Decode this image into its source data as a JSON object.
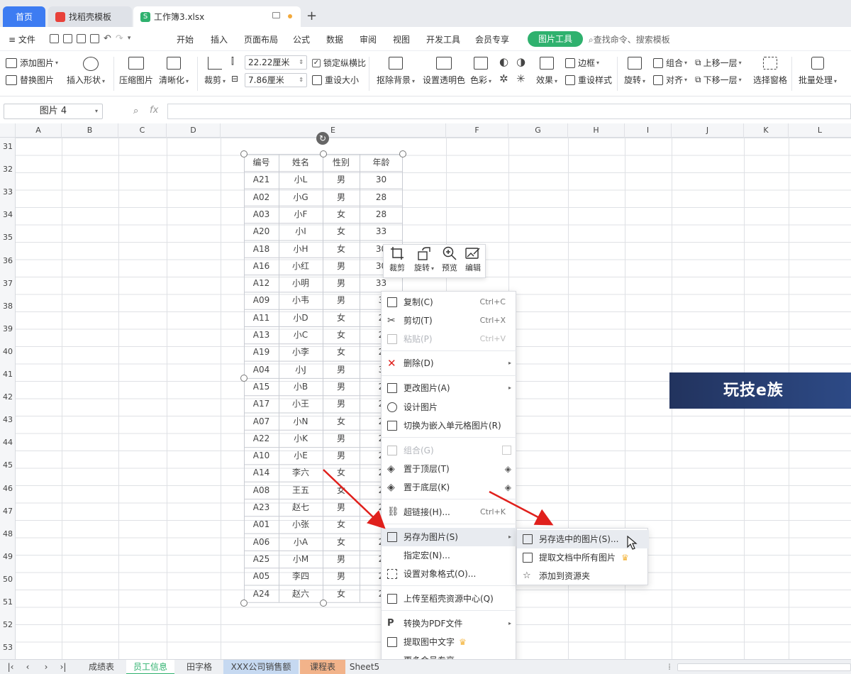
{
  "tabs": {
    "home": "首页",
    "template": "找稻壳模板",
    "workbook": "工作簿3.xlsx"
  },
  "menu": {
    "file": "文件",
    "items": [
      "开始",
      "插入",
      "页面布局",
      "公式",
      "数据",
      "审阅",
      "视图",
      "开发工具",
      "会员专享"
    ],
    "picture_tools": "图片工具",
    "search": "查找命令、搜索模板"
  },
  "ribbon": {
    "add_picture": "添加图片",
    "replace_picture": "替换图片",
    "insert_shape": "插入形状",
    "compress": "压缩图片",
    "clarify": "清晰化",
    "crop": "裁剪",
    "width": "22.22厘米",
    "height": "7.86厘米",
    "lock_ratio": "锁定纵横比",
    "reset_size": "重设大小",
    "remove_bg": "抠除背景",
    "set_transparent": "设置透明色",
    "color": "色彩",
    "effects": "效果",
    "border": "边框",
    "reset_style": "重设样式",
    "rotate": "旋转",
    "group": "组合",
    "align": "对齐",
    "bring_forward": "上移一层",
    "send_backward": "下移一层",
    "selection_pane": "选择窗格",
    "batch": "批量处理"
  },
  "formula_bar": {
    "name": "图片 4",
    "fx": "fx"
  },
  "columns": [
    "A",
    "B",
    "C",
    "D",
    "E",
    "F",
    "G",
    "H",
    "I",
    "J",
    "K",
    "L"
  ],
  "rows": [
    "31",
    "32",
    "33",
    "34",
    "35",
    "36",
    "37",
    "38",
    "39",
    "40",
    "41",
    "42",
    "43",
    "44",
    "45",
    "46",
    "47",
    "48",
    "49",
    "50",
    "51",
    "52",
    "53"
  ],
  "table": {
    "headers": [
      "编号",
      "姓名",
      "性别",
      "年龄"
    ],
    "rows": [
      [
        "A21",
        "小L",
        "男",
        "30"
      ],
      [
        "A02",
        "小G",
        "男",
        "28"
      ],
      [
        "A03",
        "小F",
        "女",
        "28"
      ],
      [
        "A20",
        "小I",
        "女",
        "33"
      ],
      [
        "A18",
        "小H",
        "女",
        "30"
      ],
      [
        "A16",
        "小红",
        "男",
        "30"
      ],
      [
        "A12",
        "小明",
        "男",
        "33"
      ],
      [
        "A09",
        "小韦",
        "男",
        "3"
      ],
      [
        "A11",
        "小D",
        "女",
        "2"
      ],
      [
        "A13",
        "小C",
        "女",
        "2"
      ],
      [
        "A19",
        "小李",
        "女",
        "2"
      ],
      [
        "A04",
        "小J",
        "男",
        "3"
      ],
      [
        "A15",
        "小B",
        "男",
        "2"
      ],
      [
        "A17",
        "小王",
        "男",
        "2"
      ],
      [
        "A07",
        "小N",
        "女",
        "2"
      ],
      [
        "A22",
        "小K",
        "男",
        "2"
      ],
      [
        "A10",
        "小E",
        "男",
        "2"
      ],
      [
        "A14",
        "李六",
        "女",
        "2"
      ],
      [
        "A08",
        "王五",
        "女",
        "2"
      ],
      [
        "A23",
        "赵七",
        "男",
        "2"
      ],
      [
        "A01",
        "小张",
        "女",
        "2"
      ],
      [
        "A06",
        "小A",
        "女",
        "2"
      ],
      [
        "A25",
        "小M",
        "男",
        "2"
      ],
      [
        "A05",
        "李四",
        "男",
        "2"
      ],
      [
        "A24",
        "赵六",
        "女",
        "2"
      ]
    ]
  },
  "mini_toolbar": [
    "裁剪",
    "旋转",
    "预览",
    "编辑"
  ],
  "context_menu": {
    "copy": "复制(C)",
    "copy_sc": "Ctrl+C",
    "cut": "剪切(T)",
    "cut_sc": "Ctrl+X",
    "paste": "粘贴(P)",
    "paste_sc": "Ctrl+V",
    "delete": "删除(D)",
    "change": "更改图片(A)",
    "design": "设计图片",
    "embed": "切换为嵌入单元格图片(R)",
    "group": "组合(G)",
    "top": "置于顶层(T)",
    "bottom": "置于底层(K)",
    "link": "超链接(H)...",
    "link_sc": "Ctrl+K",
    "save_as": "另存为图片(S)",
    "macro": "指定宏(N)...",
    "format": "设置对象格式(O)...",
    "upload": "上传至稻壳资源中心(Q)",
    "to_pdf": "转换为PDF文件",
    "extract_text": "提取图中文字",
    "more": "更多会员专享"
  },
  "submenu": {
    "save_selected": "另存选中的图片(S)...",
    "extract_all": "提取文档中所有图片",
    "add_resource": "添加到资源夹"
  },
  "watermark": "玩技e族",
  "sheets": [
    "成绩表",
    "员工信息",
    "田字格",
    "XXX公司销售额",
    "课程表",
    "Sheet5"
  ],
  "colors": {
    "accent": "#3d7cf2",
    "green": "#2fb16e",
    "arrow": "#e0201c",
    "crown": "#f4b63f"
  }
}
